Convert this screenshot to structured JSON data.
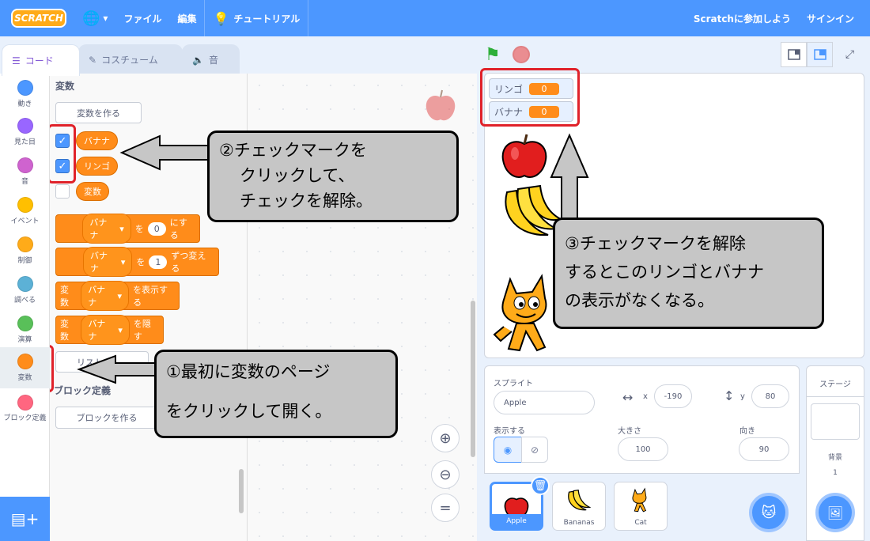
{
  "menubar": {
    "logo": "SCRATCH",
    "globe_icon": "globe-icon",
    "file": "ファイル",
    "edit": "編集",
    "tutorial": "チュートリアル",
    "join": "Scratchに参加しよう",
    "signin": "サインイン"
  },
  "tabs": {
    "code": "コード",
    "costumes": "コスチューム",
    "sounds": "音"
  },
  "categories": [
    {
      "label": "動き",
      "color": "#4c97ff"
    },
    {
      "label": "見た目",
      "color": "#9966ff"
    },
    {
      "label": "音",
      "color": "#cf63cf"
    },
    {
      "label": "イベント",
      "color": "#ffbf00"
    },
    {
      "label": "制御",
      "color": "#ffab19"
    },
    {
      "label": "調べる",
      "color": "#5cb1d6"
    },
    {
      "label": "演算",
      "color": "#59c059"
    },
    {
      "label": "変数",
      "color": "#ff8c1a"
    },
    {
      "label": "ブロック定義",
      "color": "#ff6680"
    }
  ],
  "palette": {
    "heading": "変数",
    "make_variable": "変数を作る",
    "variables": [
      {
        "name": "バナナ",
        "checked": true
      },
      {
        "name": "リンゴ",
        "checked": true
      },
      {
        "name": "変数",
        "checked": false
      }
    ],
    "blocks": {
      "set": {
        "var": "バナナ",
        "to": "を",
        "value": "0",
        "suffix": "にする"
      },
      "change": {
        "var": "バナナ",
        "by": "を",
        "value": "1",
        "suffix": "ずつ変える"
      },
      "show": {
        "prefix": "変数",
        "var": "バナナ",
        "suffix": "を表示する"
      },
      "hide": {
        "prefix": "変数",
        "var": "バナナ",
        "suffix": "を隠す"
      }
    },
    "make_list_partial": "リスト",
    "block_def_title": "ブロック定義",
    "make_block": "ブロックを作る"
  },
  "stage": {
    "monitors": [
      {
        "name": "リンゴ",
        "value": "0"
      },
      {
        "name": "バナナ",
        "value": "0"
      }
    ]
  },
  "sprite_info": {
    "sprite_label": "スプライト",
    "sprite_name": "Apple",
    "x_label": "x",
    "x_value": "-190",
    "y_label": "y",
    "y_value": "80",
    "show_label": "表示する",
    "size_label": "大きさ",
    "size_value": "100",
    "direction_label": "向き",
    "direction_value": "90"
  },
  "sprites": [
    {
      "name": "Apple",
      "selected": true
    },
    {
      "name": "Bananas",
      "selected": false
    },
    {
      "name": "Cat",
      "selected": false
    }
  ],
  "stage_pane": {
    "title": "ステージ",
    "backdrops_label": "背景",
    "backdrops_count": "1"
  },
  "annotations": {
    "step1_line1": "①最初に変数のページ",
    "step1_line2": "をクリックして開く。",
    "step2_line1": "②チェックマークを",
    "step2_line2": "クリックして、",
    "step2_line3": "チェックを解除。",
    "step3_line1": "③チェックマークを解除",
    "step3_line2": "するとこのリンゴとバナナ",
    "step3_line3": "の表示がなくなる。"
  },
  "colors": {
    "accent": "#4c97ff",
    "variables": "#ff8c1a",
    "annotation_red": "#e0222a",
    "callout_bg": "#c6c6c6"
  }
}
